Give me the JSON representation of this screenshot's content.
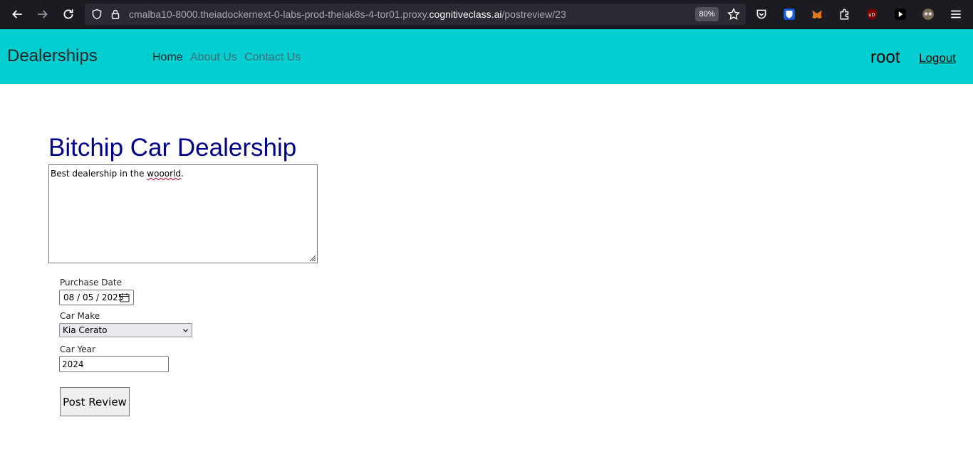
{
  "browser": {
    "url_prefix": "cmalba10-8000.theiadockernext-0-labs-prod-theiak8s-4-tor01.proxy.",
    "url_domain": "cognitiveclass.ai",
    "url_path": "/postreview/23",
    "zoom": "80%"
  },
  "navbar": {
    "brand": "Dealerships",
    "links": [
      "Home",
      "About Us",
      "Contact Us"
    ],
    "username": "root",
    "logout": "Logout",
    "background": "#00ced1"
  },
  "form": {
    "dealer_name": "Bitchip Car Dealership",
    "review_text_before": "Best dealership in the ",
    "review_text_misspelled": "wooorld",
    "review_text_after": ".",
    "purchase_date_label": "Purchase Date",
    "purchase_date_value": "08 / 05 / 2025",
    "car_make_label": "Car Make",
    "car_make_value": "Kia Cerato",
    "car_year_label": "Car Year",
    "car_year_value": "2024",
    "submit_label": "Post Review"
  }
}
